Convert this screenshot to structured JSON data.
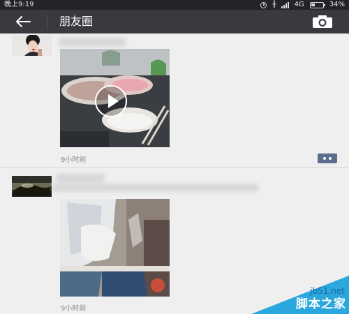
{
  "status_bar": {
    "time": "晚上9:19",
    "network": "4G",
    "battery": "34%"
  },
  "title_bar": {
    "title": "朋友圈",
    "back_icon": "arrow-left-icon",
    "camera_icon": "camera-icon"
  },
  "posts": [
    {
      "time": "9小时前",
      "media": "video",
      "comment_icon": "comment-dots-icon"
    },
    {
      "time": "9小时前",
      "media": "image"
    }
  ],
  "watermark": {
    "site": "jb51.net",
    "name": "脚本之家"
  }
}
